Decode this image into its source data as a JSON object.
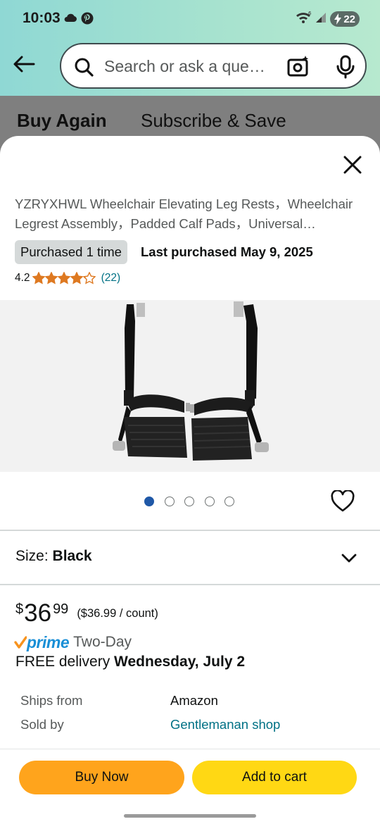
{
  "status_bar": {
    "time": "10:03",
    "battery": "22"
  },
  "search": {
    "placeholder": "Search or ask a que…"
  },
  "tabs": [
    {
      "label": "Buy Again"
    },
    {
      "label": "Subscribe & Save"
    }
  ],
  "product": {
    "title": "YZRYXHWL Wheelchair Elevating Leg Rests，Wheelchair Legrest Assembly，Padded Calf Pads，Universal…",
    "purchased_badge": "Purchased 1 time",
    "last_purchased": "Last purchased May 9, 2025",
    "rating": "4.2",
    "rating_value": 4.2,
    "review_count": "(22)",
    "image_count": 5,
    "active_image_index": 0
  },
  "size": {
    "label": "Size: ",
    "value": "Black"
  },
  "price": {
    "symbol": "$",
    "whole": "36",
    "fraction": "99",
    "per_unit": "($36.99 / count)"
  },
  "delivery": {
    "prime_label": "prime",
    "speed": "Two-Day",
    "free_text": "FREE delivery ",
    "date": "Wednesday, July 2"
  },
  "seller_info": [
    {
      "label": "Ships from",
      "value": "Amazon"
    },
    {
      "label": "Sold by",
      "value": "Gentlemanan shop"
    }
  ],
  "actions": {
    "buy_now": "Buy Now",
    "add_to_cart": "Add to cart"
  },
  "colors": {
    "buy_now": "#ffa41c",
    "add_to_cart": "#ffd814",
    "link": "#007185",
    "star": "#de7921",
    "prime": "#1a8fd6"
  }
}
